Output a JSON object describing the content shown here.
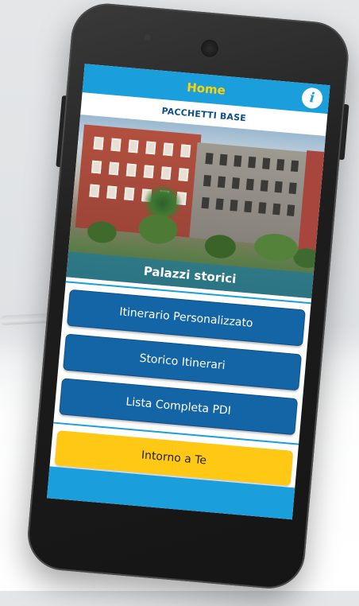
{
  "header": {
    "title": "Home",
    "info_icon": "info-icon"
  },
  "section": {
    "title": "PACCHETTI BASE"
  },
  "hero": {
    "caption": "Palazzi storici"
  },
  "buttons": {
    "custom_itinerary": "Itinerario Personalizzato",
    "itinerary_history": "Storico Itinerari",
    "poi_list": "Lista Completa PDI",
    "around_you": "Intorno a Te"
  },
  "colors": {
    "primary": "#1a9fdc",
    "button": "#1465a6",
    "accent_yellow": "#ffc814",
    "title_yellow": "#ffd200",
    "section_title": "#0f4f8a"
  }
}
